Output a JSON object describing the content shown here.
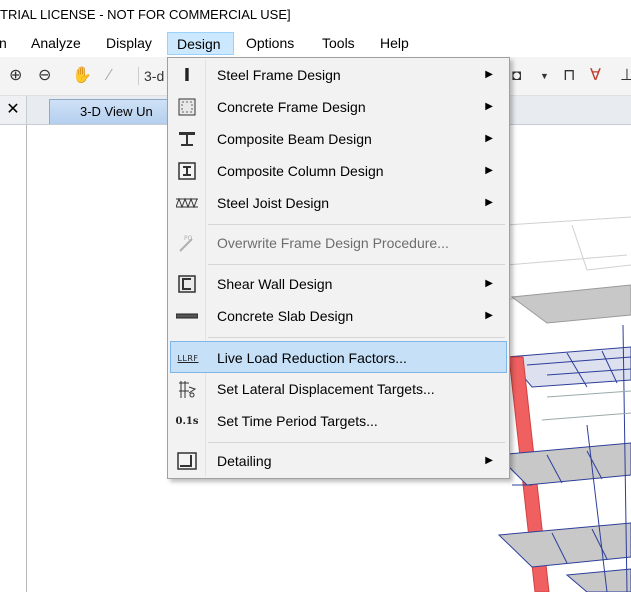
{
  "title": "TRIAL LICENSE - NOT FOR COMMERCIAL USE]",
  "menubar": {
    "items": [
      "n",
      "Analyze",
      "Display",
      "Design",
      "Options",
      "Tools",
      "Help"
    ],
    "open_item": "Design"
  },
  "toolbar": {
    "view_label": "3-d"
  },
  "tabs": {
    "close_glyph": "✕",
    "view_tab": "3-D View  Un"
  },
  "design_menu": [
    {
      "label": "Steel Frame Design",
      "icon": "steel-frame-icon",
      "submenu": true,
      "enabled": true
    },
    {
      "label": "Concrete Frame Design",
      "icon": "concrete-frame-icon",
      "submenu": true,
      "enabled": true
    },
    {
      "label": "Composite Beam Design",
      "icon": "composite-beam-icon",
      "submenu": true,
      "enabled": true
    },
    {
      "label": "Composite Column Design",
      "icon": "composite-column-icon",
      "submenu": true,
      "enabled": true
    },
    {
      "label": "Steel Joist Design",
      "icon": "steel-joist-icon",
      "submenu": true,
      "enabled": true
    },
    {
      "label": "Overwrite Frame Design Procedure...",
      "icon": "overwrite-procedure-icon",
      "submenu": false,
      "enabled": false
    },
    {
      "label": "Shear Wall Design",
      "icon": "shear-wall-icon",
      "submenu": true,
      "enabled": true
    },
    {
      "label": "Concrete Slab Design",
      "icon": "concrete-slab-icon",
      "submenu": true,
      "enabled": true
    },
    {
      "label": "Live Load Reduction Factors...",
      "icon": "llrf-icon",
      "icon_text": "LLRF",
      "submenu": false,
      "enabled": true,
      "highlighted": true
    },
    {
      "label": "Set Lateral Displacement Targets...",
      "icon": "lateral-displacement-icon",
      "submenu": false,
      "enabled": true
    },
    {
      "label": "Set Time Period Targets...",
      "icon": "time-period-icon",
      "icon_text": "0.1s",
      "submenu": false,
      "enabled": true
    },
    {
      "label": "Detailing",
      "icon": "detailing-icon",
      "submenu": true,
      "enabled": true
    }
  ],
  "colors": {
    "menu_bg": "#f2f2f2",
    "highlight": "#c5e0f7",
    "column_red": "#f06060",
    "slab_grey": "#c8c8c8",
    "beam_blue": "#2d3e9a"
  }
}
